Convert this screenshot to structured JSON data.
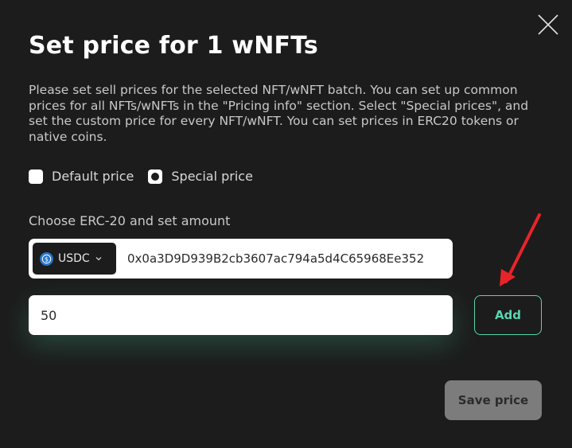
{
  "dialog": {
    "title": "Set price for 1 wNFTs",
    "description": "Please set sell prices for the selected NFT/wNFT batch. You can set up common prices for all NFTs/wNFTs in the \"Pricing info\" section. Select \"Special prices\", and set the custom price for every NFT/wNFT. You can set prices in ERC20 tokens or native coins."
  },
  "pricing_mode": {
    "options": [
      {
        "label": "Default price",
        "checked": false
      },
      {
        "label": "Special price",
        "checked": true
      }
    ]
  },
  "token": {
    "section_label": "Choose ERC-20 and set amount",
    "selected": "USDC",
    "address": "0x0a3D9D939B2cb3607ac794a5d4C65968Ee352"
  },
  "amount": {
    "value": "50"
  },
  "buttons": {
    "add": "Add",
    "save": "Save price"
  },
  "colors": {
    "background": "#1c1c1c",
    "accent": "#59d4b0",
    "annotation_arrow": "#e8232a",
    "usdc_blue": "#2775ca"
  }
}
